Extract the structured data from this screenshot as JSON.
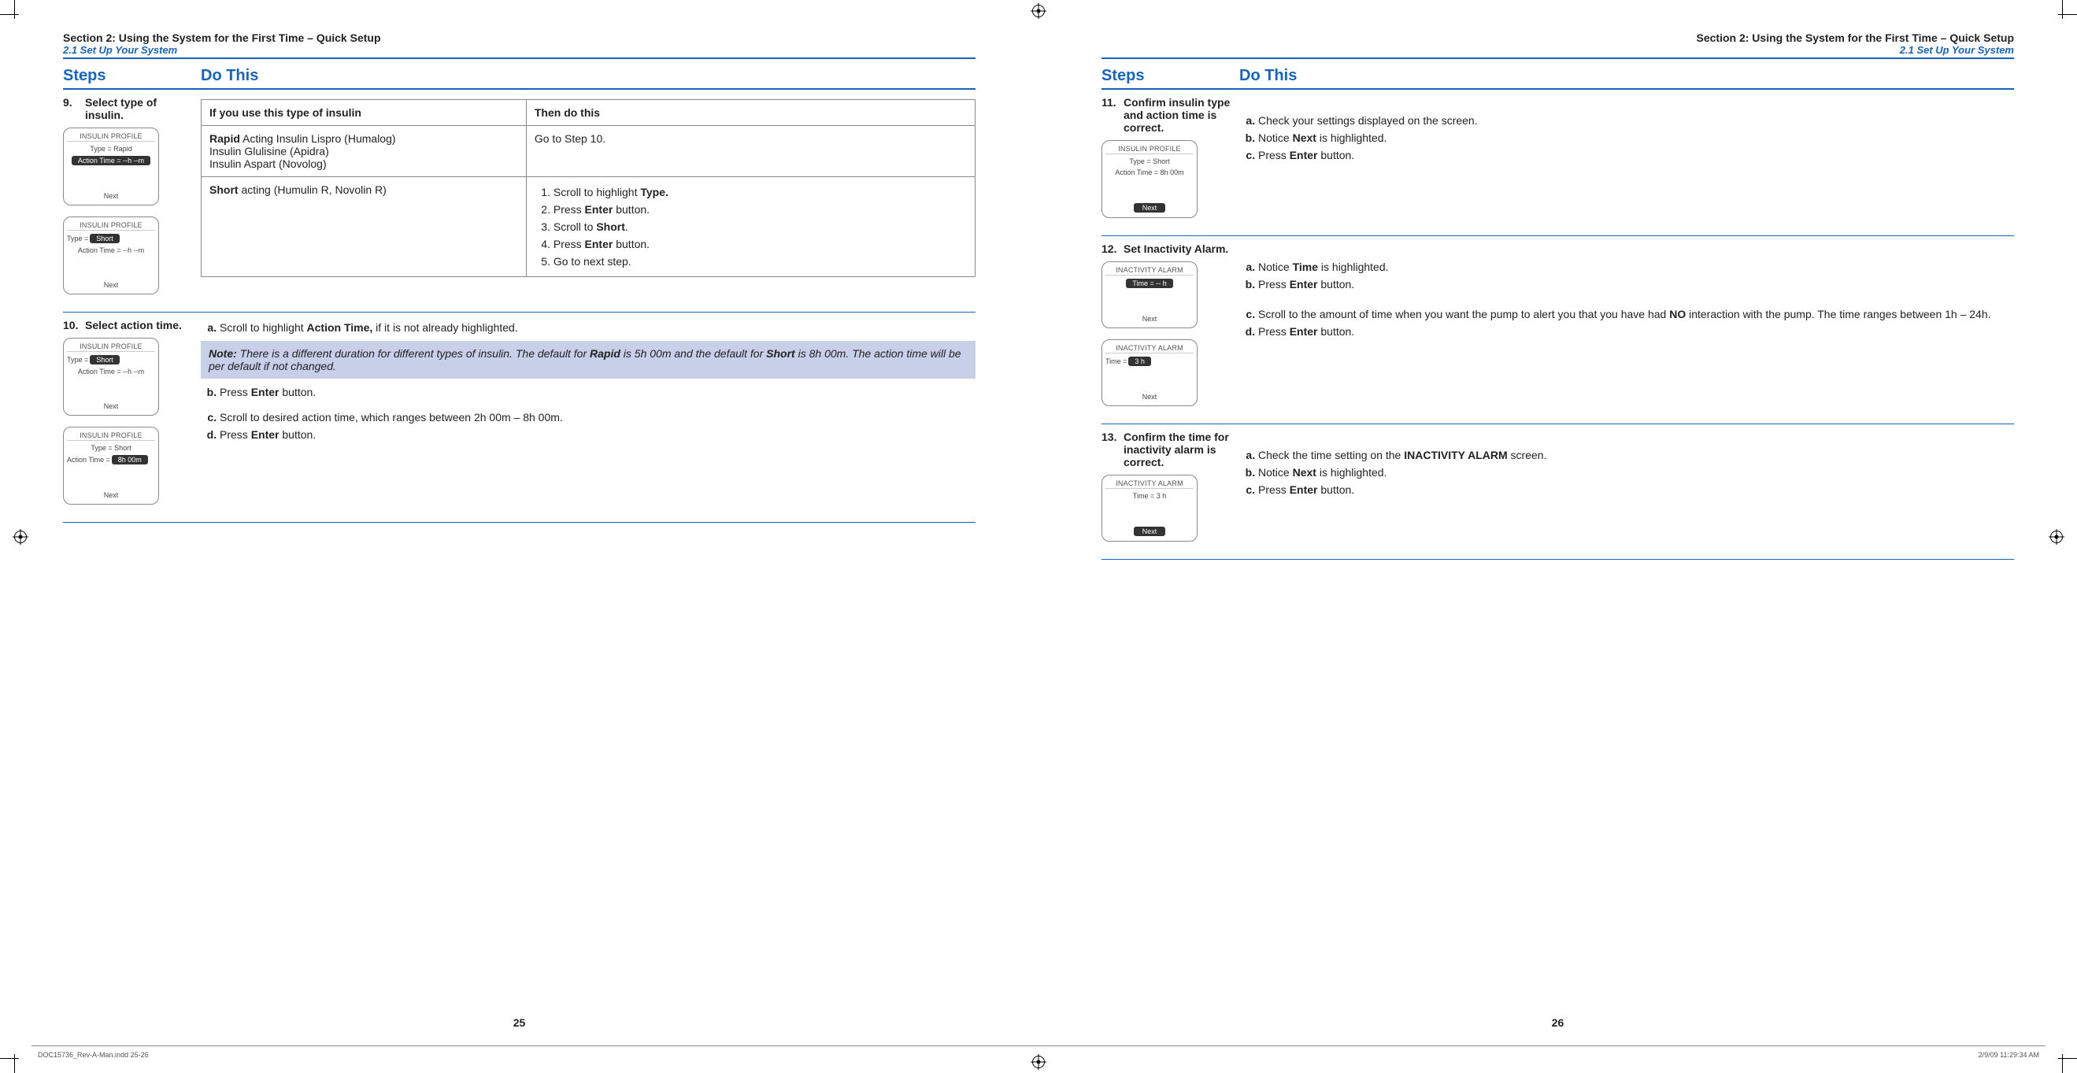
{
  "section_title": "Section 2: Using the System for the First Time – Quick Setup",
  "section_sub": "2.1 Set Up Your System",
  "col_steps": "Steps",
  "col_do": "Do This",
  "footer_file": "DOC15736_Rev-A-Man.indd   25-26",
  "footer_date": "2/9/09   11:29:34 AM",
  "left": {
    "pagenum": "25",
    "step9": {
      "num": "9.",
      "title": "Select type of insulin.",
      "device1": {
        "title": "INSULIN PROFILE",
        "l1": "Type = Rapid",
        "hl": "Action Time = --h --m",
        "foot": "Next"
      },
      "device2": {
        "title": "INSULIN PROFILE",
        "prefix": "Type =",
        "hl": "Short",
        "l2": "Action Time = --h --m",
        "foot": "Next"
      },
      "table": {
        "h1": "If you use this type of insulin",
        "h2": "Then do this",
        "r1c1_bold": "Rapid",
        "r1c1_rest": " Acting Insulin Lispro (Humalog)",
        "r1c1_l2": "Insulin Glulisine (Apidra)",
        "r1c1_l3": "Insulin Aspart (Novolog)",
        "r1c2": "Go to Step 10.",
        "r2c1_bold": "Short",
        "r2c1_rest": " acting (Humulin R, Novolin R)",
        "r2c2_1a": "Scroll to highlight ",
        "r2c2_1b": "Type.",
        "r2c2_2a": "Press ",
        "r2c2_2b": "Enter",
        "r2c2_2c": " button.",
        "r2c2_3a": "Scroll to ",
        "r2c2_3b": "Short",
        "r2c2_3c": ".",
        "r2c2_4a": "Press ",
        "r2c2_4b": "Enter",
        "r2c2_4c": " button.",
        "r2c2_5": "Go to next step."
      }
    },
    "step10": {
      "num": "10.",
      "title": "Select action time.",
      "device1": {
        "title": "INSULIN PROFILE",
        "prefix": "Type =",
        "hl": "Short",
        "l2": "Action Time = --h --m",
        "foot": "Next"
      },
      "device2": {
        "title": "INSULIN PROFILE",
        "l1": "Type = Short",
        "prefix": "Action Time =",
        "hl": "8h 00m",
        "foot": "Next"
      },
      "a1": "Scroll to highlight ",
      "a2": "Action Time,",
      "a3": " if it is not already highlighted.",
      "note1": "Note:",
      "note2": " There is a different duration for different types of insulin. The default for ",
      "note3": "Rapid",
      "note4": " is 5h 00m and the default for ",
      "note5": "Short",
      "note6": " is 8h 00m. The action time will be per default if not changed.",
      "b1": "Press ",
      "b2": "Enter",
      "b3": " button.",
      "c": "Scroll to desired action time, which ranges between 2h 00m – 8h 00m.",
      "d1": "Press ",
      "d2": "Enter",
      "d3": " button."
    }
  },
  "right": {
    "pagenum": "26",
    "step11": {
      "num": "11.",
      "title": "Confirm insulin type and action time is correct.",
      "device": {
        "title": "INSULIN PROFILE",
        "l1": "Type = Short",
        "l2": "Action Time = 8h 00m",
        "foot": "Next"
      },
      "a": "Check your settings displayed on the screen.",
      "b1": "Notice ",
      "b2": "Next",
      "b3": " is highlighted.",
      "c1": "Press ",
      "c2": "Enter",
      "c3": " button."
    },
    "step12": {
      "num": "12.",
      "title": "Set Inactivity Alarm.",
      "device1": {
        "title": "INACTIVITY ALARM",
        "hl": "Time = --  h",
        "foot": "Next"
      },
      "device2": {
        "title": "INACTIVITY ALARM",
        "prefix": "Time =",
        "hl": "3  h",
        "foot": "Next"
      },
      "a1": "Notice ",
      "a2": "Time",
      "a3": " is highlighted.",
      "b1": "Press ",
      "b2": "Enter",
      "b3": " button.",
      "c1": "Scroll to the amount of time when you want the pump to alert you that you have had ",
      "c2": "NO",
      "c3": " interaction with the pump. The time ranges between 1h – 24h.",
      "d1": "Press ",
      "d2": "Enter",
      "d3": " button."
    },
    "step13": {
      "num": "13.",
      "title": "Confirm the time for inactivity alarm is correct.",
      "device": {
        "title": "INACTIVITY ALARM",
        "l1": "Time = 3 h",
        "foot": "Next"
      },
      "a1": "Check the time setting on the ",
      "a2": "INACTIVITY ALARM",
      "a3": " screen.",
      "b1": "Notice ",
      "b2": "Next",
      "b3": " is highlighted.",
      "c1": "Press ",
      "c2": "Enter",
      "c3": " button."
    }
  }
}
